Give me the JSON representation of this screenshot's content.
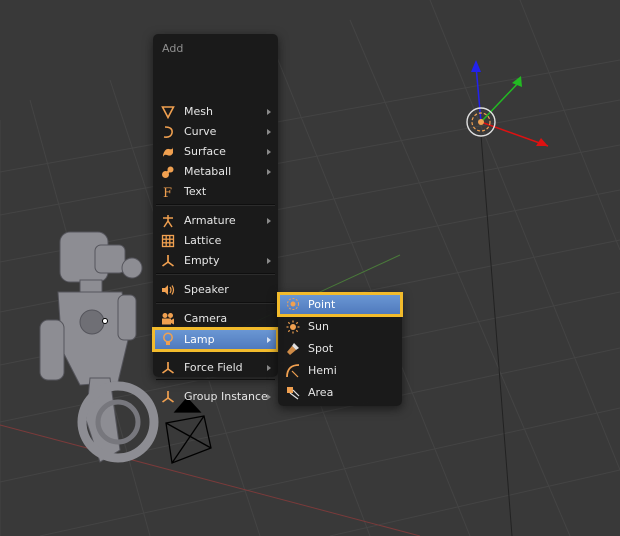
{
  "menu": {
    "title": "Add",
    "items": [
      {
        "label": "Mesh",
        "icon": "mesh-icon",
        "submenu": true
      },
      {
        "label": "Curve",
        "icon": "curve-icon",
        "submenu": true
      },
      {
        "label": "Surface",
        "icon": "surface-icon",
        "submenu": true
      },
      {
        "label": "Metaball",
        "icon": "metaball-icon",
        "submenu": true
      },
      {
        "label": "Text",
        "icon": "text-icon",
        "submenu": false
      },
      {
        "label": "Armature",
        "icon": "armature-icon",
        "submenu": true
      },
      {
        "label": "Lattice",
        "icon": "lattice-icon",
        "submenu": false
      },
      {
        "label": "Empty",
        "icon": "empty-icon",
        "submenu": true
      },
      {
        "label": "Speaker",
        "icon": "speaker-icon",
        "submenu": false
      },
      {
        "label": "Camera",
        "icon": "camera-icon",
        "submenu": false
      },
      {
        "label": "Lamp",
        "icon": "lamp-icon",
        "submenu": true,
        "highlighted": true
      },
      {
        "label": "Force Field",
        "icon": "force-field-icon",
        "submenu": true
      },
      {
        "label": "Group Instance",
        "icon": "group-instance-icon",
        "submenu": true
      }
    ]
  },
  "lamp_submenu": {
    "items": [
      {
        "label": "Point",
        "icon": "point-lamp-icon",
        "highlighted": true
      },
      {
        "label": "Sun",
        "icon": "sun-lamp-icon"
      },
      {
        "label": "Spot",
        "icon": "spot-lamp-icon"
      },
      {
        "label": "Hemi",
        "icon": "hemi-lamp-icon"
      },
      {
        "label": "Area",
        "icon": "area-lamp-icon"
      }
    ]
  },
  "colors": {
    "viewport_background": "#393939",
    "menu_background": "#181818",
    "highlight": "#5680c2",
    "focus_outline": "#f2bb2c",
    "icon_orange": "#f0a050",
    "axis_x": "#dd1111",
    "axis_y": "#22bb22",
    "axis_z": "#2222ee"
  }
}
